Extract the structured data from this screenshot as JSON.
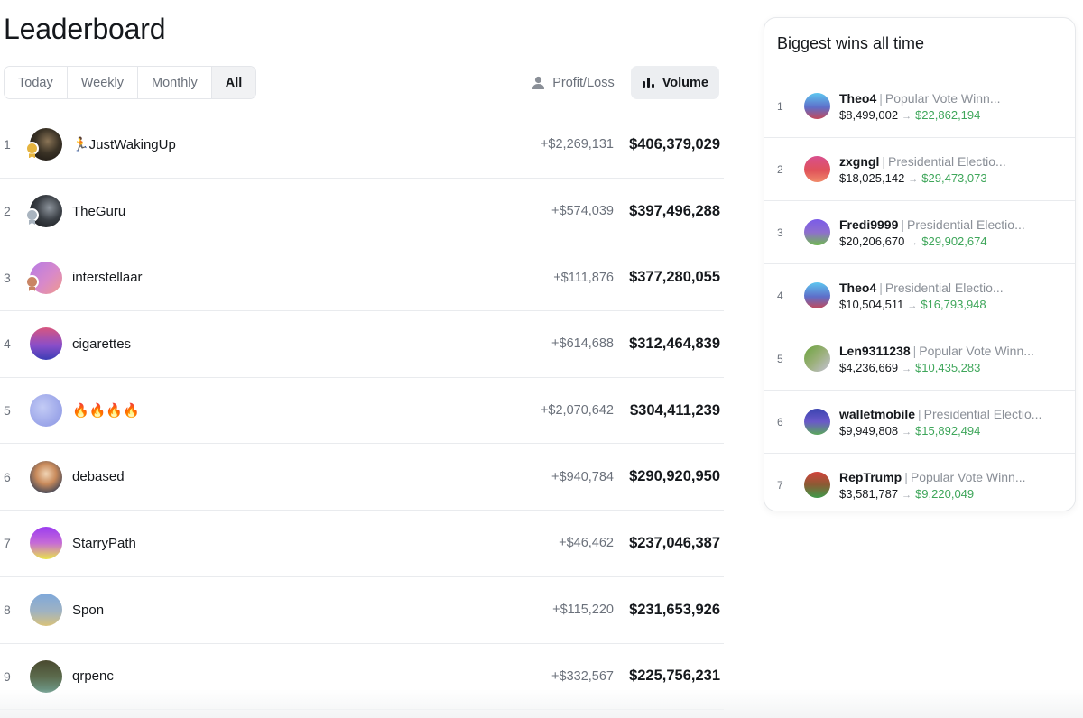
{
  "page": {
    "title": "Leaderboard"
  },
  "tabs": [
    {
      "label": "Today",
      "active": false
    },
    {
      "label": "Weekly",
      "active": false
    },
    {
      "label": "Monthly",
      "active": false
    },
    {
      "label": "All",
      "active": true
    }
  ],
  "metrics": [
    {
      "label": "Profit/Loss",
      "icon": "user-icon",
      "active": false
    },
    {
      "label": "Volume",
      "icon": "bar-chart-icon",
      "active": true
    }
  ],
  "leaderboard": [
    {
      "rank": "1",
      "name": "🏃JustWakingUp",
      "pnl": "+$2,269,131",
      "volume": "$406,379,029",
      "medal": "#e5b43f",
      "avatar": "radial-gradient(circle at 55% 40%, #8a7456 0%, #3b3326 45%, #151210 100%)"
    },
    {
      "rank": "2",
      "name": "TheGuru",
      "pnl": "+$574,039",
      "volume": "$397,496,288",
      "medal": "#a9b4bf",
      "avatar": "radial-gradient(circle at 60% 40%, #8d949c 0%, #3a3f45 45%, #111315 100%)"
    },
    {
      "rank": "3",
      "name": "interstellaar",
      "pnl": "+$111,876",
      "volume": "$377,280,055",
      "medal": "#c98565",
      "avatar": "linear-gradient(135deg, #b67be6 0%, #d889c9 55%, #f09a8a 100%)"
    },
    {
      "rank": "4",
      "name": "cigarettes",
      "pnl": "+$614,688",
      "volume": "$312,464,839",
      "medal": "",
      "avatar": "linear-gradient(180deg, #d8567f 0%, #8a4ec9 55%, #3c3db5 100%)"
    },
    {
      "rank": "5",
      "name": "🔥🔥🔥🔥",
      "pnl": "+$2,070,642",
      "volume": "$304,411,239",
      "medal": "",
      "avatar": "radial-gradient(circle at 40% 40%, #c3cbf5 0%, #9fa9ea 60%, #8d97e3 100%)"
    },
    {
      "rank": "6",
      "name": "debased",
      "pnl": "+$940,784",
      "volume": "$290,920,950",
      "medal": "",
      "avatar": "radial-gradient(circle at 50% 40%, #f1d5b6 0%, #c88a5b 40%, #2f3d57 85%)"
    },
    {
      "rank": "7",
      "name": "StarryPath",
      "pnl": "+$46,462",
      "volume": "$237,046,387",
      "medal": "",
      "avatar": "linear-gradient(180deg, #9b3cf0 0%, #c66bd7 50%, #e8e44a 100%)"
    },
    {
      "rank": "8",
      "name": "Spon",
      "pnl": "+$115,220",
      "volume": "$231,653,926",
      "medal": "",
      "avatar": "linear-gradient(180deg, #7ea8db 0%, #9fb2c2 55%, #d9c27a 100%)"
    },
    {
      "rank": "9",
      "name": "qrpenc",
      "pnl": "+$332,567",
      "volume": "$225,756,231",
      "medal": "",
      "avatar": "linear-gradient(180deg, #4a4a2f 0%, #5b6a4c 50%, #6f9c8d 100%)"
    }
  ],
  "biggest_wins": {
    "title": "Biggest wins all time",
    "items": [
      {
        "rank": "1",
        "user": "Theo4",
        "market": "Popular Vote Winn...",
        "from": "$8,499,002",
        "to": "$22,862,194",
        "avatar": "linear-gradient(180deg, #5ec7f0 0%, #5e6ec9 55%, #c4495a 100%)"
      },
      {
        "rank": "2",
        "user": "zxgngl",
        "market": "Presidential Electio...",
        "from": "$18,025,142",
        "to": "$29,473,073",
        "avatar": "linear-gradient(180deg, #d84f8e 0%, #e0525a 55%, #f08a6a 100%)"
      },
      {
        "rank": "3",
        "user": "Fredi9999",
        "market": "Presidential Electio...",
        "from": "$20,206,670",
        "to": "$29,902,674",
        "avatar": "linear-gradient(180deg, #7a5be8 0%, #8e6fce 50%, #6fb94f 100%)"
      },
      {
        "rank": "4",
        "user": "Theo4",
        "market": "Presidential Electio...",
        "from": "$10,504,511",
        "to": "$16,793,948",
        "avatar": "linear-gradient(180deg, #5ec7f0 0%, #5e6ec9 55%, #c4495a 100%)"
      },
      {
        "rank": "5",
        "user": "Len9311238",
        "market": "Popular Vote Winn...",
        "from": "$4,236,669",
        "to": "$10,435,283",
        "avatar": "linear-gradient(135deg, #6aa33b 0%, #9bb07a 50%, #c6c2d8 100%)"
      },
      {
        "rank": "6",
        "user": "walletmobile",
        "market": "Presidential Electio...",
        "from": "$9,949,808",
        "to": "$15,892,494",
        "avatar": "linear-gradient(180deg, #3b44b0 0%, #6a59c9 50%, #5aa85a 100%)"
      },
      {
        "rank": "7",
        "user": "RepTrump",
        "market": "Popular Vote Winn...",
        "from": "$3,581,787",
        "to": "$9,220,049",
        "avatar": "linear-gradient(180deg, #d2433c 0%, #8a5b34 50%, #3f9a4a 100%)"
      }
    ]
  },
  "colors": {
    "positive": "#3ea65a",
    "muted": "#6b717b",
    "border": "#e9ebee"
  }
}
